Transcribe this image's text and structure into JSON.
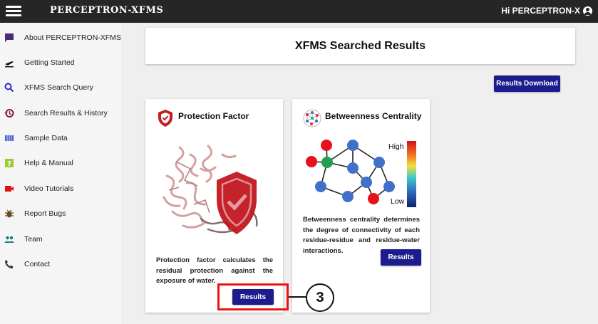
{
  "app": {
    "logo": "PERCEPTRON-XFMS",
    "user_greeting": "Hi PERCEPTRON-X"
  },
  "sidebar": {
    "items": [
      {
        "label": "About PERCEPTRON-XFMS",
        "icon": "chat-bubble-icon"
      },
      {
        "label": "Getting Started",
        "icon": "airplane-takeoff-icon"
      },
      {
        "label": "XFMS Search Query",
        "icon": "search-icon"
      },
      {
        "label": "Search Results & History",
        "icon": "history-icon"
      },
      {
        "label": "Sample Data",
        "icon": "data-table-icon"
      },
      {
        "label": "Help & Manual",
        "icon": "help-icon"
      },
      {
        "label": "Video Tutorials",
        "icon": "video-camera-icon"
      },
      {
        "label": "Report Bugs",
        "icon": "bug-icon"
      },
      {
        "label": "Team",
        "icon": "people-icon"
      },
      {
        "label": "Contact",
        "icon": "phone-icon"
      }
    ]
  },
  "main": {
    "title": "XFMS Searched Results",
    "download_button": "Results Download",
    "cards": [
      {
        "title": "Protection Factor",
        "description": "Protection factor calculates the residual protection against the exposure of water.",
        "button": "Results"
      },
      {
        "title": "Betweenness Centrality",
        "description": "Betweenness centrality determines the degree of connectivity of each residue-residue and residue-water interactions.",
        "button": "Results",
        "scale_high": "High",
        "scale_low": "Low"
      }
    ],
    "annotation_step": "3"
  },
  "colors": {
    "topbar": "#262626",
    "accent_button": "#1c1c8c",
    "highlight": "#ee1111",
    "shield_red": "#c41c20"
  }
}
